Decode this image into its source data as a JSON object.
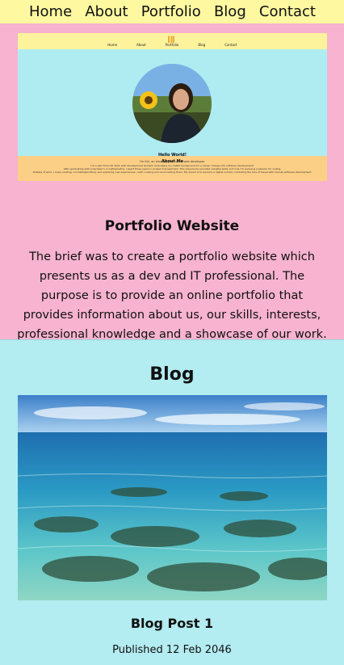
{
  "nav": {
    "items": [
      "Home",
      "About",
      "Portfolio",
      "Blog",
      "Contact"
    ]
  },
  "portfolio": {
    "thumbnail": {
      "logo": "ǀǁ",
      "nav_items": [
        "Home",
        "About",
        "Portfolio",
        "Blog",
        "Contact"
      ],
      "hello": "Hello World!",
      "subtitle": "I'm Kiri, an emerging full stack web developer.",
      "about_title": "About Me",
      "about_lines": [
        "I'm a part time full stack web development student, leveraging my health background for a career change into software development.",
        "After graduating with a bachelor's in mathematics, I spent three years in project management. This experience provided valuable skills, but now I'm pursuing a passion for coding.",
        "Outside of work, I enjoy reading, crocheting/knitting, and exploring new experiences - both cooking and reconnecting them. My dream is to become a digital nomad, combining the love of travel with remote software development."
      ]
    },
    "title": "Portfolio Website",
    "description": "The brief was to create a portfolio website which presents us as a dev and IT professional. The purpose is to provide an online portfolio that provides information about us, our skills, interests, professional knowledge and a showcase of our work."
  },
  "blog": {
    "heading": "Blog",
    "post_title": "Blog Post 1",
    "post_date": "Published 12 Feb 2046"
  },
  "colors": {
    "nav_bg": "#fef8a1",
    "portfolio_bg": "#f7b3cf",
    "blog_bg": "#b3ecf1",
    "thumb_hero_bg": "#aeecf2",
    "thumb_about_bg": "#fccf86"
  }
}
